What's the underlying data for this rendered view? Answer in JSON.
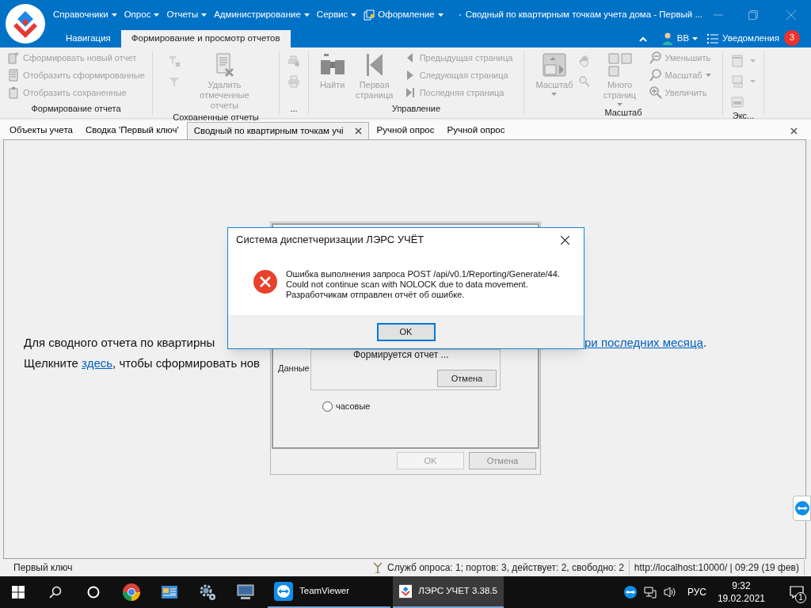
{
  "window": {
    "menu": [
      {
        "label": "Справочники",
        "dropdown": true
      },
      {
        "label": "Опрос",
        "dropdown": true
      },
      {
        "label": "Отчеты",
        "dropdown": true
      },
      {
        "label": "Администрирование",
        "dropdown": true
      },
      {
        "label": "Сервис",
        "dropdown": true
      },
      {
        "label": "Оформление",
        "dropdown": true
      }
    ],
    "title": "Сводный по квартирным точкам учета дома - Первый ..."
  },
  "ribbon_tabs": [
    {
      "label": "Навигация",
      "selected": false
    },
    {
      "label": "Формирование и просмотр отчетов",
      "selected": true
    }
  ],
  "user": {
    "name": "ВВ"
  },
  "notifications": {
    "label": "Уведомления",
    "count": "3"
  },
  "ribbon_groups": [
    {
      "title": "Формирование отчета",
      "columns": [
        [
          {
            "kind": "small",
            "label": "Сформировать новый отчет",
            "disabled": true
          },
          {
            "kind": "small",
            "label": "Отобразить сформированные",
            "disabled": true
          },
          {
            "kind": "small",
            "label": "Отобразить сохраненные",
            "disabled": true
          }
        ]
      ]
    },
    {
      "title": "Сохраненные отчеты",
      "columns": [
        [
          {
            "kind": "icon",
            "disabled": true
          },
          {
            "kind": "icon",
            "disabled": true
          }
        ],
        [
          {
            "kind": "large",
            "label": "Удалить отмеченные отчеты",
            "disabled": true
          }
        ]
      ]
    },
    {
      "title": "...",
      "columns": [
        [
          {
            "kind": "icon",
            "disabled": true
          },
          {
            "kind": "icon",
            "disabled": true
          }
        ]
      ]
    },
    {
      "title": "Управление",
      "columns": [
        [
          {
            "kind": "large",
            "label": "Найти",
            "disabled": true
          }
        ],
        [
          {
            "kind": "large",
            "label": "Первая страница",
            "disabled": true
          }
        ],
        [
          {
            "kind": "small",
            "label": "Предыдущая страница",
            "disabled": true
          },
          {
            "kind": "small",
            "label": "Следующая страница",
            "disabled": true
          },
          {
            "kind": "small",
            "label": "Последняя страница",
            "disabled": true
          }
        ]
      ]
    },
    {
      "title": "Масштаб",
      "columns": [
        [
          {
            "kind": "large",
            "label": "Масштаб",
            "disabled": true,
            "dropdown": true
          }
        ],
        [
          {
            "kind": "icon",
            "disabled": true
          },
          {
            "kind": "icon",
            "disabled": true
          }
        ],
        [
          {
            "kind": "large",
            "label": "Много страниц",
            "disabled": true,
            "dropdown": true
          }
        ],
        [
          {
            "kind": "small",
            "label": "Уменьшить",
            "disabled": true
          },
          {
            "kind": "small",
            "label": "Масштаб",
            "disabled": true,
            "dropdown": true
          },
          {
            "kind": "small",
            "label": "Увеличить",
            "disabled": true
          }
        ]
      ]
    },
    {
      "title": "Экс...",
      "columns": [
        [
          {
            "kind": "icon",
            "disabled": true,
            "dropdown": true
          },
          {
            "kind": "icon",
            "disabled": true,
            "dropdown": true
          },
          {
            "kind": "icon",
            "disabled": true
          }
        ]
      ]
    }
  ],
  "document_tabs": [
    {
      "label": "Объекты учета",
      "selected": false,
      "closable": false
    },
    {
      "label": "Сводка 'Первый ключ'",
      "selected": false,
      "closable": false
    },
    {
      "label": "Сводный по квартирным точкам учі",
      "selected": true,
      "closable": true
    },
    {
      "label": "Ручной опрос",
      "selected": false,
      "closable": false
    },
    {
      "label": "Ручной опрос",
      "selected": false,
      "closable": false
    }
  ],
  "content": {
    "line_1": {
      "text": "Для сводного отчета по квартирны",
      "link": "ри последних месяца",
      "after": "."
    },
    "line_2": {
      "text": "Щелкните ",
      "link": "здесь",
      "after": ", чтобы сформировать нов"
    }
  },
  "background_dialog": {
    "label": "Данные",
    "progress_text": "Формируется отчет ...",
    "progress_cancel": "Отмена",
    "radio": [
      {
        "label": "часовые",
        "selected": false
      }
    ],
    "buttons": [
      {
        "label": "OK",
        "disabled": true
      },
      {
        "label": "Отмена",
        "disabled": false
      }
    ]
  },
  "error_dialog": {
    "title": "Система диспетчеризации ЛЭРС УЧЁТ",
    "message": [
      "Ошибка выполнения запроса POST /api/v0.1/Reporting/Generate/44.",
      "Could not continue scan with NOLOCK due to data movement.",
      "Разработчикам отправлен отчёт об ошибке."
    ],
    "button": "OK"
  },
  "status_bar": {
    "left": "Первый ключ",
    "services": "Служб опроса: 1; портов: 3, действует: 2, свободно: 2",
    "server": "http://localhost:10000/ | 09:29 (19 фев)"
  },
  "taskbar": {
    "apps": [
      {
        "label": "TeamViewer",
        "selected": false
      },
      {
        "label": "ЛЭРС УЧЕТ 3.38.5",
        "selected": true
      }
    ],
    "language": "РУС",
    "time": "9:32",
    "date": "19.02.2021",
    "notification_count": "1"
  }
}
